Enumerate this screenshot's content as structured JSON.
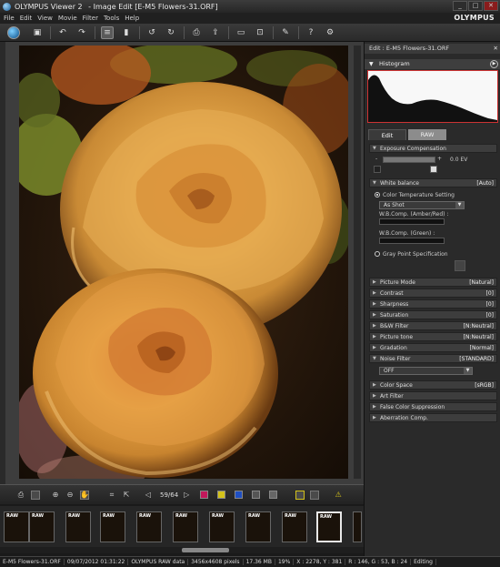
{
  "window": {
    "app_name": "OLYMPUS Viewer 2",
    "separator": "-",
    "title": "Image Edit [E-M5 Flowers-31.ORF]",
    "brand": "OLYMPUS"
  },
  "menu": [
    "File",
    "Edit",
    "View",
    "Movie",
    "Filter",
    "Tools",
    "Help"
  ],
  "toolbar": {
    "icons": [
      "home-icon",
      "save-icon",
      "undo-icon",
      "redo-icon",
      "panel-view-icon",
      "info-icon",
      "rotate-left-icon",
      "rotate-right-icon",
      "print-icon",
      "share-icon",
      "compare-icon",
      "resize-icon",
      "edit-icon",
      "help-icon",
      "settings-icon"
    ]
  },
  "navigation": {
    "counter": "59/64",
    "prev_symbol": "◁",
    "next_symbol": "▷"
  },
  "status": {
    "filename": "E-M5 Flowers-31.ORF",
    "datetime": "09/07/2012 01:31:22",
    "filetype": "OLYMPUS RAW data",
    "pixels": "3456x4608 pixels",
    "filesize": "17.36 MB",
    "zoom": "19%",
    "coords": "X : 2278, Y : 381",
    "rgb": "R : 146, G : 53, B : 24",
    "mode": "Editing"
  },
  "right_panel": {
    "header": "Edit : E-M5 Flowers-31.ORF",
    "histogram_label": "Histogram",
    "tabs": [
      "Edit",
      "RAW"
    ],
    "exposure": {
      "label": "Exposure Compensation",
      "value": "0.0 EV",
      "minus": "-",
      "plus": "+"
    },
    "white_balance": {
      "label": "White balance",
      "value": "[Auto]",
      "color_temp_setting": "Color Temperature Setting",
      "preset": "As Shot",
      "wb_amber": "W.B.Comp. (Amber/Red) :",
      "wb_green": "W.B.Comp. (Green) :",
      "gray_point": "Gray Point Specification"
    },
    "sections": [
      {
        "label": "Picture Mode",
        "value": "[Natural]"
      },
      {
        "label": "Contrast",
        "value": "[0]"
      },
      {
        "label": "Sharpness",
        "value": "[0]"
      },
      {
        "label": "Saturation",
        "value": "[0]"
      },
      {
        "label": "B&W Filter",
        "value": "[N:Neutral]"
      },
      {
        "label": "Picture tone",
        "value": "[N:Neutral]"
      },
      {
        "label": "Gradation",
        "value": "[Normal]"
      },
      {
        "label": "Noise Filter",
        "value": "[STANDARD]"
      }
    ],
    "noise_filter_option": "OFF",
    "more_sections": [
      {
        "label": "Color Space",
        "value": "[sRGB]"
      },
      {
        "label": "Art Filter",
        "value": ""
      },
      {
        "label": "False Color Suppression",
        "value": ""
      },
      {
        "label": "Aberration Comp.",
        "value": ""
      }
    ]
  },
  "filmstrip": {
    "raw_badge": "RAW",
    "count": 10
  }
}
